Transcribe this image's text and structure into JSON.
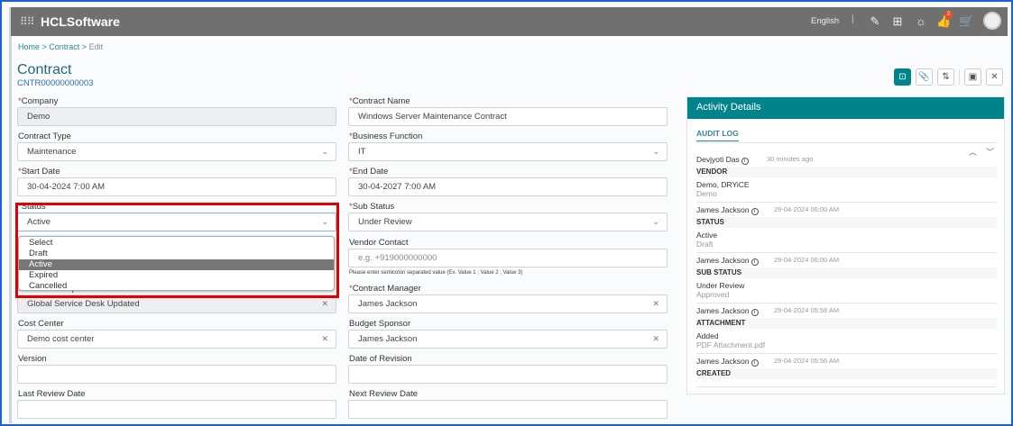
{
  "header": {
    "brand": "HCLSoftware",
    "language": "English",
    "notification_count": "2"
  },
  "breadcrumb": [
    "Home",
    "Contract",
    "Edit"
  ],
  "page": {
    "title": "Contract",
    "id": "CNTR00000000003"
  },
  "form": {
    "company": {
      "label": "Company",
      "value": "Demo"
    },
    "contract_name": {
      "label": "Contract Name",
      "value": "Windows Server Maintenance Contract"
    },
    "contract_type": {
      "label": "Contract Type",
      "value": "Maintenance"
    },
    "business_function": {
      "label": "Business Function",
      "value": "IT"
    },
    "start_date": {
      "label": "Start Date",
      "value": "30-04-2024 7:00 AM"
    },
    "end_date": {
      "label": "End Date",
      "value": "30-04-2027 7:00 AM"
    },
    "status": {
      "label": "Status",
      "value": "Active",
      "options": [
        "Select",
        "Draft",
        "Active",
        "Expired",
        "Cancelled"
      ]
    },
    "sub_status": {
      "label": "Sub Status",
      "value": "Under Review"
    },
    "vendor_contact": {
      "label": "Vendor Contact",
      "placeholder": "e.g. +919000000000",
      "hint": "Please enter semicolon separated value (Ex. Value 1 ; Value 2 ; Value 3)"
    },
    "contract_group": {
      "label": "Contract Group",
      "value": "Global Service Desk Updated"
    },
    "contract_manager": {
      "label": "Contract Manager",
      "value": "James Jackson"
    },
    "cost_center": {
      "label": "Cost Center",
      "value": "Demo cost center"
    },
    "budget_sponsor": {
      "label": "Budget Sponsor",
      "value": "James Jackson"
    },
    "version": {
      "label": "Version",
      "value": ""
    },
    "date_of_revision": {
      "label": "Date of Revision",
      "value": ""
    },
    "last_review_date": {
      "label": "Last Review Date",
      "value": ""
    },
    "next_review_date": {
      "label": "Next Review Date",
      "value": ""
    }
  },
  "activity": {
    "title": "Activity Details",
    "tab": "AUDIT LOG",
    "entries": [
      {
        "user": "Devjyoti Das",
        "time": "30 minutes ago",
        "field": "VENDOR",
        "new": "Demo, DRYiCE",
        "old": "Demo"
      },
      {
        "user": "James Jackson",
        "time": "29-04-2024 06:00 AM",
        "field": "STATUS",
        "new": "Active",
        "old": "Draft"
      },
      {
        "user": "James Jackson",
        "time": "29-04-2024 06:00 AM",
        "field": "SUB STATUS",
        "new": "Under Review",
        "old": "Approved"
      },
      {
        "user": "James Jackson",
        "time": "29-04-2024 05:58 AM",
        "field": "ATTACHMENT",
        "new": "Added",
        "old": "PDF Attachment.pdf"
      },
      {
        "user": "James Jackson",
        "time": "29-04-2024 05:56 AM",
        "field": "CREATED"
      }
    ]
  }
}
